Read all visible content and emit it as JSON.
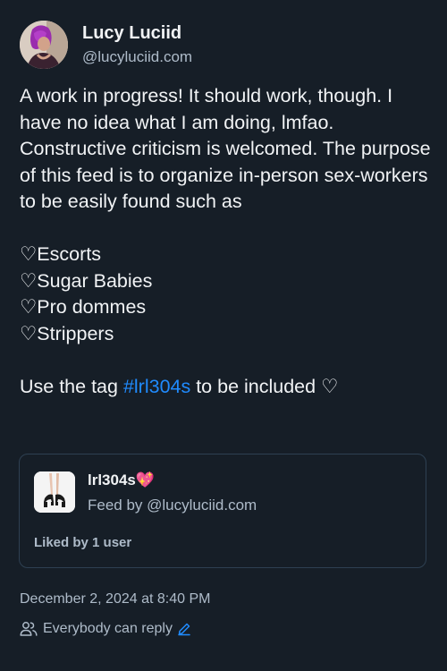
{
  "post": {
    "author": {
      "display_name": "Lucy Luciid",
      "handle": "@lucyluciid.com",
      "avatar_icon": "user-avatar-photo"
    },
    "text": {
      "intro": "A work in progress! It should work, though. I have no idea what I am doing, lmfao. Constructive criticism is welcomed. The purpose of this feed is to organize in-person sex-workers to be easily found such as",
      "list_items": [
        "Escorts",
        "Sugar Babies",
        "Pro dommes",
        "Strippers"
      ],
      "list_glyph": "♡",
      "tag_prefix": "Use the tag ",
      "tag": "#lrl304s",
      "tag_suffix": " to be included ♡"
    },
    "embedded_feed": {
      "name": "lrl304s💖",
      "byline": "Feed by @lucyluciid.com",
      "likes": "Liked by 1 user",
      "thumbnail_icon": "high-heels-photo"
    },
    "timestamp": "December 2, 2024 at 8:40 PM",
    "reply_setting": {
      "label": "Everybody can reply",
      "icon": "people-icon",
      "edit_icon": "pencil-icon"
    }
  },
  "colors": {
    "background": "#161e27",
    "text": "#f1f3f5",
    "muted_text": "#aebbc9",
    "link": "#208bfe",
    "border": "#2e4052"
  }
}
